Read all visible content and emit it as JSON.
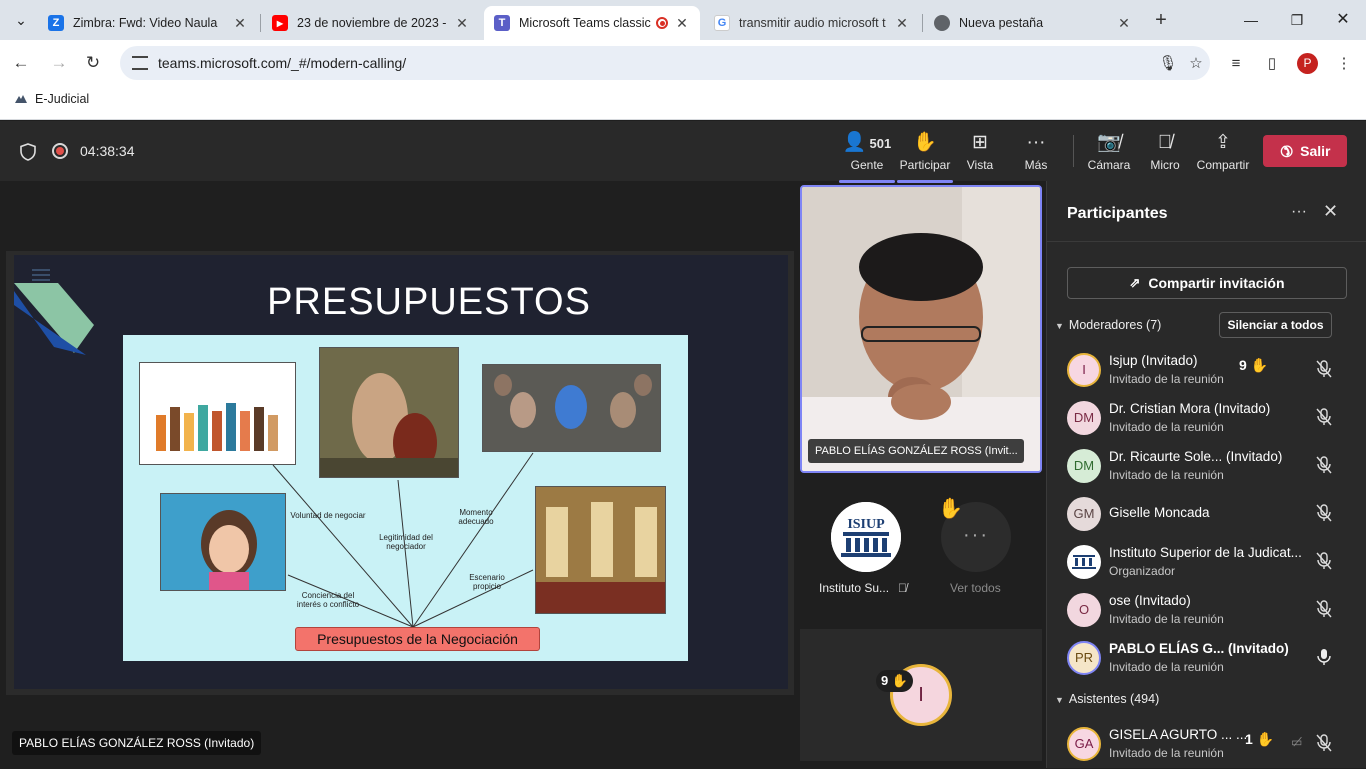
{
  "browser": {
    "tabs": [
      {
        "title": "Zimbra: Fwd: Video Naula",
        "favicon": "zimbra-icon"
      },
      {
        "title": "23 de noviembre de 2023 -",
        "favicon": "youtube-icon"
      },
      {
        "title": "Microsoft Teams classic",
        "favicon": "teams-icon"
      },
      {
        "title": "transmitir audio microsoft t",
        "favicon": "google-icon"
      },
      {
        "title": "Nueva pestaña",
        "favicon": "chrome-icon"
      }
    ],
    "url": "teams.microsoft.com/_#/modern-calling/",
    "profile_initial": "P",
    "bookmarks": [
      {
        "label": "E-Judicial"
      }
    ]
  },
  "meeting": {
    "timer": "04:38:34",
    "controls": {
      "people": {
        "label": "Gente",
        "count": "501"
      },
      "raise": {
        "label": "Participar"
      },
      "view": {
        "label": "Vista"
      },
      "more": {
        "label": "Más"
      },
      "camera": {
        "label": "Cámara"
      },
      "mic": {
        "label": "Micro"
      },
      "share": {
        "label": "Compartir"
      },
      "leave": {
        "label": "Salir"
      }
    },
    "presenter_label": "PABLO ELÍAS GONZÁLEZ ROSS (Invitado)",
    "slide": {
      "title": "PRESUPUESTOS",
      "center_box": "Presupuestos de la Negociación",
      "labels": {
        "voluntad": "Voluntad de negociar",
        "legitimidad": "Legitimidad del negociador",
        "momento": "Momento adecuado",
        "conciencia": "Conciencia del interés o conflicto",
        "escenario": "Escenario propicio"
      }
    },
    "stage": {
      "video_name": "PABLO ELÍAS GONZÁLEZ ROSS (Invit...",
      "tile_name": "Instituto Su...",
      "logo_text": "ISIUP",
      "see_all": "Ver todos",
      "raised_count": "9",
      "big_avatar": "I"
    }
  },
  "participants_panel": {
    "title": "Participantes",
    "invite_label": "Compartir invitación",
    "mute_all_label": "Silenciar a todos",
    "moderators_heading": "Moderadores (7)",
    "attendees_heading": "Asistentes (494)",
    "moderators": [
      {
        "initials": "I",
        "name": "Isjup (Invitado)",
        "role": "Invitado de la reunión",
        "hand": "9"
      },
      {
        "initials": "DM",
        "name": "Dr. Cristian Mora (Invitado)",
        "role": "Invitado de la reunión"
      },
      {
        "initials": "DM",
        "name": "Dr. Ricaurte Sole...  (Invitado)",
        "role": "Invitado de la reunión"
      },
      {
        "initials": "GM",
        "name": "Giselle Moncada",
        "role": ""
      },
      {
        "initials": "",
        "name": "Instituto Superior de la Judicat...",
        "role": "Organizador"
      },
      {
        "initials": "O",
        "name": "ose (Invitado)",
        "role": "Invitado de la reunión"
      },
      {
        "initials": "PR",
        "name": "PABLO ELÍAS G...   (Invitado)",
        "role": "Invitado de la reunión"
      }
    ],
    "attendees": [
      {
        "initials": "GA",
        "name": "GISELA AGURTO ... ...",
        "role": "Invitado de la reunión",
        "hand": "1"
      }
    ]
  },
  "colors": {
    "accent": "#7f85f5",
    "leave": "#c4314b",
    "hand": "#f5b800"
  }
}
